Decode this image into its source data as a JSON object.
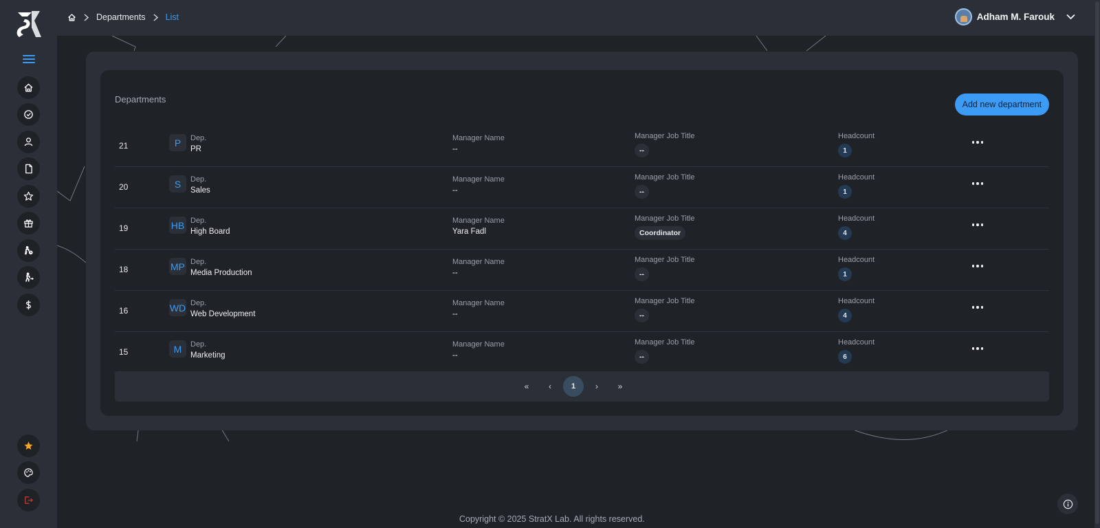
{
  "app": {
    "logo_icon": "stratx-logo-icon"
  },
  "breadcrumb": {
    "home_icon": "home-icon",
    "items": [
      "Departments",
      "List"
    ]
  },
  "user": {
    "name": "Adham M. Farouk"
  },
  "sidebar": {
    "items": [
      {
        "icon": "home-icon"
      },
      {
        "icon": "check-circle-icon"
      },
      {
        "icon": "user-icon"
      },
      {
        "icon": "document-icon"
      },
      {
        "icon": "star-icon"
      },
      {
        "icon": "gift-icon"
      },
      {
        "icon": "person-clock-icon"
      },
      {
        "icon": "person-walking-icon"
      },
      {
        "icon": "dollar-icon"
      }
    ],
    "bottom": [
      {
        "icon": "star-filled-icon",
        "color": "#f5a623"
      },
      {
        "icon": "palette-icon"
      },
      {
        "icon": "logout-icon",
        "color": "#c0392b"
      }
    ]
  },
  "panel": {
    "title": "Departments",
    "add_button": "Add new department"
  },
  "columns": {
    "dep": "Dep.",
    "manager_name": "Manager Name",
    "manager_job_title": "Manager Job Title",
    "headcount": "Headcount"
  },
  "rows": [
    {
      "id": "21",
      "initials": "P",
      "name": "PR",
      "manager": "--",
      "job_title": "--",
      "headcount": "1"
    },
    {
      "id": "20",
      "initials": "S",
      "name": "Sales",
      "manager": "--",
      "job_title": "--",
      "headcount": "1"
    },
    {
      "id": "19",
      "initials": "HB",
      "name": "High Board",
      "manager": "Yara Fadl",
      "job_title": "Coordinator",
      "headcount": "4"
    },
    {
      "id": "18",
      "initials": "MP",
      "name": "Media Production",
      "manager": "--",
      "job_title": "--",
      "headcount": "1"
    },
    {
      "id": "16",
      "initials": "WD",
      "name": "Web Development",
      "manager": "--",
      "job_title": "--",
      "headcount": "4"
    },
    {
      "id": "15",
      "initials": "M",
      "name": "Marketing",
      "manager": "--",
      "job_title": "--",
      "headcount": "6"
    }
  ],
  "pagination": {
    "first": "«",
    "prev": "‹",
    "current": "1",
    "next": "›",
    "last": "»"
  },
  "footer": {
    "copyright": "Copyright © 2025 StratX Lab. All rights reserved."
  },
  "colors": {
    "accent": "#3b9bf5",
    "background": "#1f2227",
    "panel": "#2b3038"
  }
}
